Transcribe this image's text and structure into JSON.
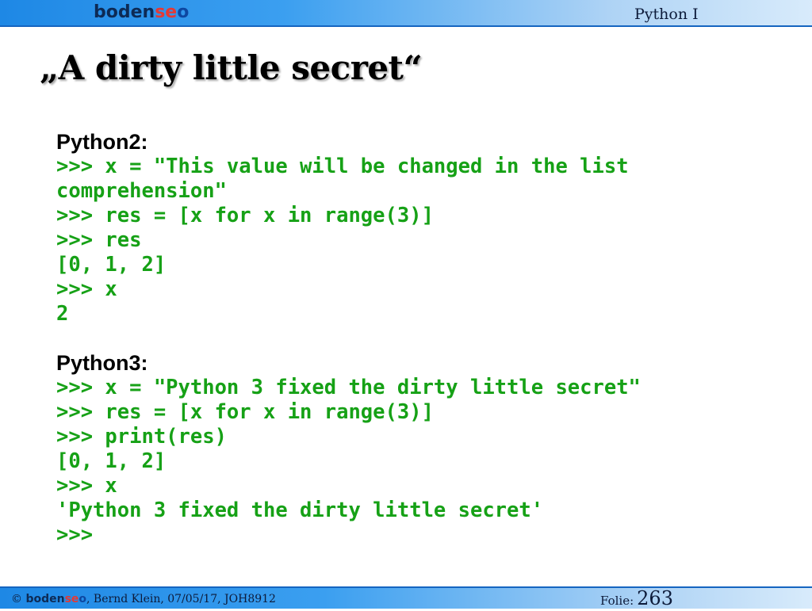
{
  "header": {
    "logo": {
      "part1": "boden",
      "part2": "se",
      "part3": "o"
    },
    "course": "Python I"
  },
  "title": "„A dirty little secret“",
  "sections": [
    {
      "heading": "Python2:",
      "lines": [
        ">>> x = \"This value will be changed in the list",
        "comprehension\"",
        ">>> res = [x for x in range(3)]",
        ">>> res",
        "[0, 1, 2]",
        ">>> x",
        "2"
      ]
    },
    {
      "heading": "Python3:",
      "lines": [
        ">>> x = \"Python 3 fixed the dirty little secret\"",
        ">>> res = [x for x in range(3)]",
        ">>> print(res)",
        "[0, 1, 2]",
        ">>> x",
        "'Python 3 fixed the dirty little secret'",
        ">>>"
      ]
    }
  ],
  "footer": {
    "copyright": "©",
    "logo": {
      "part1": "boden",
      "part2": "se",
      "part3": "o"
    },
    "credits": ", Bernd Klein, 07/05/17, JOH8912",
    "folie_label": "Folie:",
    "slide_number": "263"
  },
  "colors": {
    "code": "#16a116",
    "header_start": "#1e88e5",
    "header_end": "#d8ebfb",
    "logo_accent": "#e53935"
  }
}
